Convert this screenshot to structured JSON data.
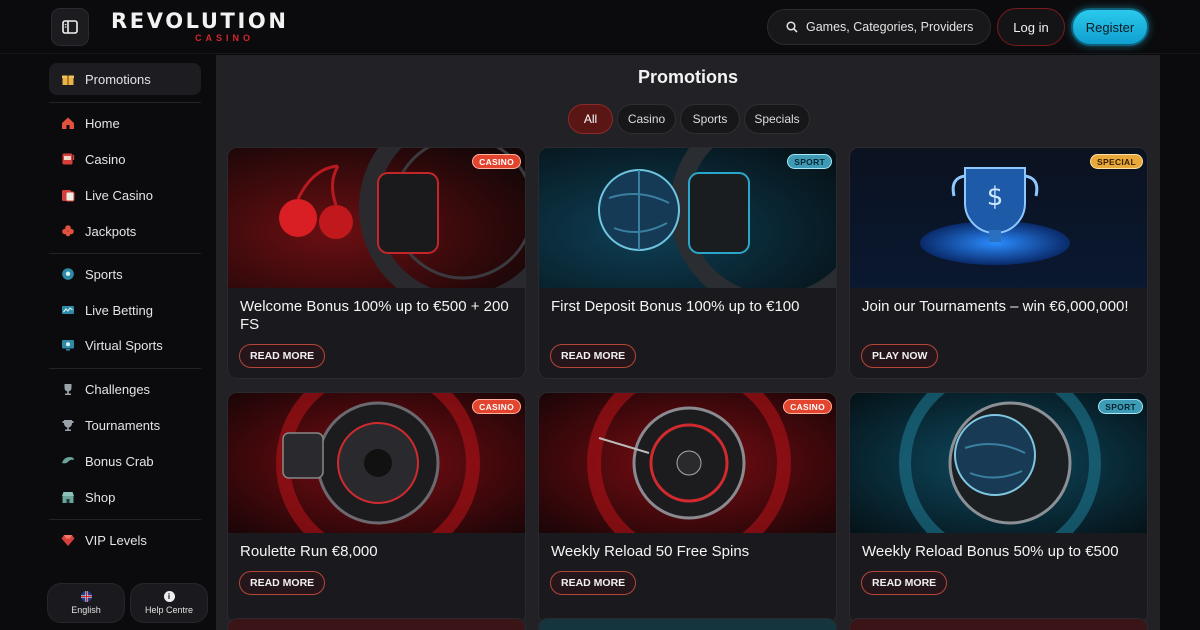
{
  "header": {
    "logo_main": "REVOLUTION",
    "logo_sub": "CASINO",
    "search_placeholder": "Games, Categories, Providers",
    "login_label": "Log in",
    "register_label": "Register"
  },
  "sidebar": {
    "items": [
      {
        "label": "Promotions",
        "icon": "gift-icon"
      },
      {
        "label": "Home",
        "icon": "home-icon"
      },
      {
        "label": "Casino",
        "icon": "slot-machine-icon"
      },
      {
        "label": "Live Casino",
        "icon": "live-dealer-icon"
      },
      {
        "label": "Jackpots",
        "icon": "clover-icon"
      },
      {
        "label": "Sports",
        "icon": "soccer-ball-icon"
      },
      {
        "label": "Live Betting",
        "icon": "live-screen-icon"
      },
      {
        "label": "Virtual Sports",
        "icon": "monitor-icon"
      },
      {
        "label": "Challenges",
        "icon": "trophy-icon"
      },
      {
        "label": "Tournaments",
        "icon": "cup-icon"
      },
      {
        "label": "Bonus Crab",
        "icon": "crab-claw-icon"
      },
      {
        "label": "Shop",
        "icon": "shop-icon"
      },
      {
        "label": "VIP Levels",
        "icon": "diamond-icon"
      }
    ],
    "language_label": "English",
    "help_label": "Help Centre"
  },
  "main": {
    "title": "Promotions",
    "filters": [
      "All",
      "Casino",
      "Sports",
      "Specials"
    ],
    "active_filter": "All",
    "cards": [
      {
        "title": "Welcome Bonus 100% up to €500 + 200 FS",
        "button": "READ MORE",
        "badge": "CASINO"
      },
      {
        "title": "First Deposit Bonus 100% up to €100",
        "button": "READ MORE",
        "badge": "SPORT"
      },
      {
        "title": "Join our Tournaments – win €6,000,000!",
        "button": "PLAY NOW",
        "badge": "SPECIAL"
      },
      {
        "title": "Roulette Run €8,000",
        "button": "READ MORE",
        "badge": "CASINO"
      },
      {
        "title": "Weekly Reload 50 Free Spins",
        "button": "READ MORE",
        "badge": "CASINO"
      },
      {
        "title": "Weekly Reload Bonus 50% up to €500",
        "button": "READ MORE",
        "badge": "SPORT"
      }
    ]
  },
  "colors": {
    "accent_red": "#d6262c",
    "register_cyan": "#1fb6e0",
    "badge_casino": "#e3442d",
    "badge_sport": "#3e9bb5",
    "badge_special": "#e8a83a"
  }
}
